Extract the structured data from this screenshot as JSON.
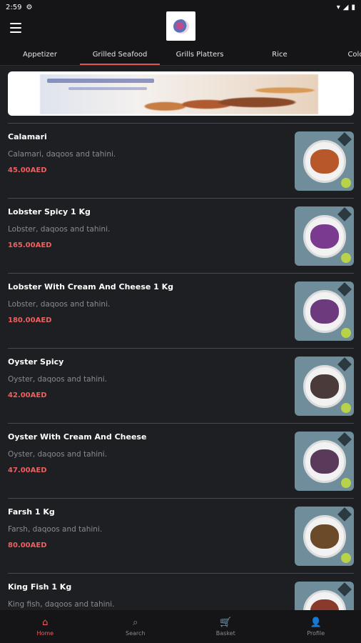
{
  "status": {
    "time": "2:59",
    "gear": "⚙",
    "wifi": "▾",
    "signal": "◢",
    "battery": "▮"
  },
  "header": {
    "menu_icon": "menu-icon",
    "logo": "restaurant-logo"
  },
  "tabs": [
    {
      "label": "Appetizer",
      "active": false
    },
    {
      "label": "Grilled Seafood",
      "active": true
    },
    {
      "label": "Grills Platters",
      "active": false
    },
    {
      "label": "Rice",
      "active": false
    },
    {
      "label": "Cold D",
      "active": false
    }
  ],
  "banner": {
    "image": "seafood-banner"
  },
  "items": [
    {
      "name": "Calamari",
      "desc": "Calamari, daqoos and tahini.",
      "price": "45.00AED",
      "food_color": "#b8572a"
    },
    {
      "name": "Lobster Spicy 1 Kg",
      "desc": "Lobster, daqoos and tahini.",
      "price": "165.00AED",
      "food_color": "#7a3b8e"
    },
    {
      "name": "Lobster With Cream And Cheese 1 Kg",
      "desc": "Lobster, daqoos and tahini.",
      "price": "180.00AED",
      "food_color": "#6e3a7e"
    },
    {
      "name": "Oyster Spicy",
      "desc": "Oyster, daqoos and tahini.",
      "price": "42.00AED",
      "food_color": "#4a3a3a"
    },
    {
      "name": "Oyster With Cream And Cheese",
      "desc": "Oyster, daqoos and tahini.",
      "price": "47.00AED",
      "food_color": "#5a3a5a"
    },
    {
      "name": "Farsh 1 Kg",
      "desc": "Farsh, daqoos and tahini.",
      "price": "80.00AED",
      "food_color": "#6b4a2a"
    },
    {
      "name": "King Fish 1 Kg",
      "desc": "King fish, daqoos and tahini.",
      "price": "",
      "food_color": "#8a3a2a"
    }
  ],
  "bottom_nav": [
    {
      "label": "Home",
      "icon": "⌂",
      "active": true
    },
    {
      "label": "Search",
      "icon": "⌕",
      "active": false
    },
    {
      "label": "Basket",
      "icon": "🛒",
      "active": false
    },
    {
      "label": "Profile",
      "icon": "👤",
      "active": false
    }
  ],
  "colors": {
    "accent": "#ef5f5f",
    "background": "#1e1f22",
    "bar": "#151518"
  }
}
